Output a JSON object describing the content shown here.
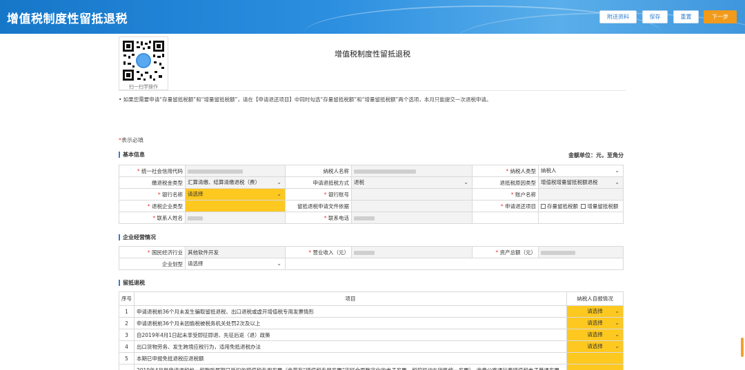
{
  "header": {
    "title": "增值税制度性留抵退税",
    "buttons": [
      "附送资料",
      "保存",
      "重置",
      "下一步"
    ]
  },
  "qr": {
    "label": "扫一扫学操作"
  },
  "form_title": "增值税制度性留抵退税",
  "notice": "• 如果您需要申请“存量留抵税额”和“增量留抵税额”，请在【申请退还项目】中同时勾选“存量留抵税额”和“增量留抵税额”两个选项，本月只能提交一次退税申请。",
  "required_note": {
    "star": "*",
    "text": "表示必填"
  },
  "basic": {
    "section_title": "基本信息",
    "unit": "金额单位：元，至角分",
    "rows": [
      [
        {
          "label": "统一社会信用代码",
          "required": true,
          "value": ""
        },
        {
          "label": "纳税人名称",
          "required": false,
          "value": ""
        },
        {
          "label": "纳税人类型",
          "required": true,
          "value": "纳税人"
        }
      ],
      [
        {
          "label": "缴退税金类型",
          "required": false,
          "value": "汇算清缴、结算清缴退税（费）"
        },
        {
          "label": "申请退抵税方式",
          "required": false,
          "value": "退税"
        },
        {
          "label": "退抵税原因类型",
          "required": false,
          "value": "增值税增量留抵税额退税"
        }
      ],
      [
        {
          "label": "银行名称",
          "required": true,
          "value": "请选择"
        },
        {
          "label": "银行账号",
          "required": true,
          "value": ""
        },
        {
          "label": "账户名称",
          "required": true,
          "value": ""
        }
      ],
      [
        {
          "label": "退税企业类型",
          "required": true,
          "value": ""
        },
        {
          "label": "留抵退税申请文件依据",
          "required": false,
          "value": ""
        },
        {
          "label": "申请退还项目",
          "required": true,
          "value": ""
        }
      ],
      [
        {
          "label": "联系人姓名",
          "required": true,
          "value": ""
        },
        {
          "label": "联系电话",
          "required": true,
          "value": ""
        },
        {
          "label": "",
          "required": false,
          "value": ""
        }
      ]
    ],
    "refund_items": [
      "存量留抵税额",
      "增量留抵税额"
    ]
  },
  "enterprise": {
    "section_title": "企业经营情况",
    "industry_label": "国民经济行业",
    "industry_value": "其他软件开发",
    "revenue_label": "营业收入（元）",
    "assets_label": "资产总额（元）",
    "scale_label": "企业划型",
    "scale_value": "请选择"
  },
  "retain": {
    "section_title": "留抵退税",
    "headers": {
      "no": "序号",
      "item": "项目",
      "report": "纳税人自报情况"
    },
    "rows": [
      {
        "no": "1",
        "item": "申请退税前36个月未发生骗取留抵退税、出口退税或虚开增值税专用发票情形",
        "value": "请选择"
      },
      {
        "no": "2",
        "item": "申请退税前36个月未因偷税被税务机关处罚2次及以上",
        "value": "请选择"
      },
      {
        "no": "3",
        "item": "自2019年4月1日起未享受即征即退、先征后返（退）政策",
        "value": "请选择"
      },
      {
        "no": "4",
        "item": "出口货物劳务、发生跨境应税行为，适用免抵退税办法",
        "value": "请选择"
      },
      {
        "no": "5",
        "item": "本期已申报免抵退税应退税额",
        "value": ""
      },
      {
        "no": "",
        "item": "2019年4月至申请退税前一税款所属期已抵扣的增值税专用发票（含带有“增值税专用发票”字样全面数字化的电子发票、税控机动车销售统一发票）、收费公路通行费增值税电子普通发票",
        "value": ""
      }
    ]
  },
  "colors": {
    "header": "#1f7fd6",
    "accent": "#2f7fd0",
    "required": "#e33333",
    "highlight": "#fdc81f",
    "next_button": "#f29a1a"
  }
}
